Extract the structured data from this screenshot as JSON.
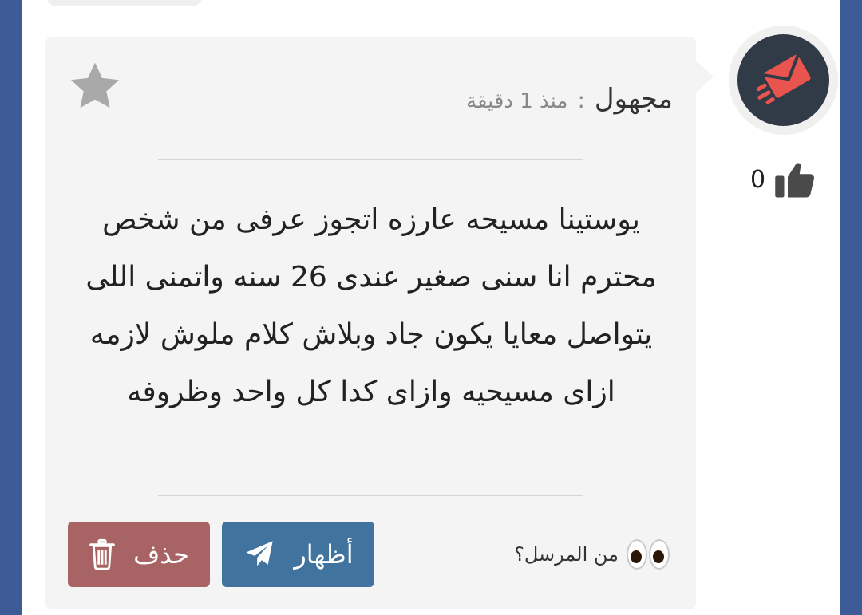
{
  "top_fragment": "... ",
  "question": {
    "sender_name": "مجهول",
    "separator": ":",
    "time_ago": "منذ 1 دقيقة",
    "message": "يوستينا مسيحه عارزه اتجوز عرفى من شخص محترم انا سنى صغير عندى 26 سنه واتمنى اللى يتواصل معايا يكون جاد وبلاش كلام ملوش لازمه ازاى مسيحيه وازاى كدا كل واحد وظروفه",
    "reveal_hint": "من المرسل؟",
    "likes": "0"
  },
  "actions": {
    "reveal_label": "أظهار",
    "delete_label": "حذف"
  },
  "icons": {
    "star": "star-icon",
    "avatar": "envelope-logo",
    "like": "thumbs-up-icon",
    "eyes": "eyes-emoji",
    "reveal": "paper-plane-icon",
    "delete": "trash-icon"
  },
  "colors": {
    "page_background": "#3d5c97",
    "card_background": "#f4f4f4",
    "reveal_button": "#40749e",
    "delete_button": "#a86464",
    "avatar_background": "#313a47",
    "avatar_accent": "#e9544e"
  }
}
